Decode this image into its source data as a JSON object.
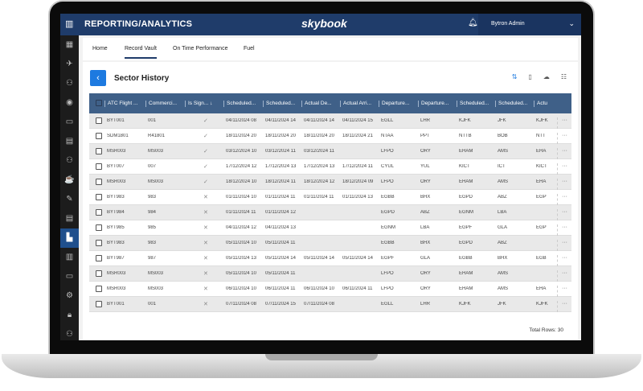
{
  "header": {
    "title": "REPORTING/ANALYTICS",
    "logo": "skybook",
    "user": "Bytron Admin",
    "app_icon": "bar-chart-icon",
    "bell_icon": "bell-icon",
    "chevron_icon": "chevron-down-icon"
  },
  "sidebar": {
    "icons": [
      "grid-icon",
      "drone-icon",
      "people-icon",
      "globe-icon",
      "monitor-icon",
      "list-icon",
      "people-settings-icon",
      "coffee-icon",
      "pin-icon",
      "clipboard-icon",
      "reports-icon",
      "columns-icon",
      "screen-icon",
      "gears-icon",
      "lock-icon",
      "user-icon"
    ],
    "active": 10
  },
  "tabs": [
    {
      "label": "Home"
    },
    {
      "label": "Record Vault",
      "active": true
    },
    {
      "label": "On Time Performance"
    },
    {
      "label": "Fuel"
    }
  ],
  "page": {
    "title": "Sector History",
    "back_icon": "chevron-left-icon",
    "tools": [
      "refresh-icon",
      "clipboard-icon",
      "cloud-download-icon",
      "columns-icon"
    ]
  },
  "table": {
    "columns": [
      "ATC Flight ...",
      "Commerci...",
      "Is Sign... ↓",
      "Scheduled...",
      "Scheduled...",
      "Actual De...",
      "Actual Arri...",
      "Departure...",
      "Departure...",
      "Scheduled...",
      "Scheduled...",
      "Actu"
    ],
    "rows": [
      [
        "BYT001",
        "001",
        "✓",
        "04/11/2024 08",
        "04/11/2024 14",
        "04/11/2024 14",
        "04/11/2024 15",
        "EGLL",
        "LHR",
        "KJFK",
        "JFK",
        "KJFK"
      ],
      [
        "SDM1801",
        "R41801",
        "✓",
        "18/11/2024 20",
        "18/11/2024 20",
        "18/11/2024 20",
        "18/11/2024 21",
        "NTAA",
        "PPT",
        "NTTB",
        "BOB",
        "NTT"
      ],
      [
        "MSR003",
        "MS003",
        "✓",
        "03/12/2024 10",
        "03/12/2024 11",
        "03/12/2024 11",
        "",
        "LFPO",
        "ORY",
        "EHAM",
        "AMS",
        "EHA"
      ],
      [
        "BYT007",
        "007",
        "✓",
        "17/12/2024 12",
        "17/12/2024 13",
        "17/12/2024 13",
        "17/12/2024 11",
        "CYUL",
        "YUL",
        "KICT",
        "ICT",
        "KICT"
      ],
      [
        "MSR003",
        "MS003",
        "✓",
        "18/12/2024 10",
        "18/12/2024 11",
        "18/12/2024 12",
        "18/12/2024 09",
        "LFPO",
        "ORY",
        "EHAM",
        "AMS",
        "EHA"
      ],
      [
        "BYT983",
        "983",
        "✕",
        "01/11/2024 10",
        "01/11/2024 11",
        "01/11/2024 11",
        "01/11/2024 13",
        "EGBB",
        "BHX",
        "EGPD",
        "ABZ",
        "EGP"
      ],
      [
        "BYT984",
        "984",
        "✕",
        "01/11/2024 11",
        "01/11/2024 12",
        "",
        "",
        "EGPD",
        "ABZ",
        "EGNM",
        "LBA",
        ""
      ],
      [
        "BYT985",
        "985",
        "✕",
        "04/11/2024 12",
        "04/11/2024 13",
        "",
        "",
        "EGNM",
        "LBA",
        "EGPF",
        "GLA",
        "EGP"
      ],
      [
        "BYT983",
        "983",
        "✕",
        "05/11/2024 10",
        "05/11/2024 11",
        "",
        "",
        "EGBB",
        "BHX",
        "EGPD",
        "ABZ",
        ""
      ],
      [
        "BYT987",
        "987",
        "✕",
        "05/11/2024 13",
        "05/11/2024 14",
        "05/11/2024 14",
        "05/11/2024 14",
        "EGPF",
        "GLA",
        "EGBB",
        "BHX",
        "EGB"
      ],
      [
        "MSR003",
        "MS003",
        "✕",
        "05/11/2024 10",
        "05/11/2024 11",
        "",
        "",
        "LFPO",
        "ORY",
        "EHAM",
        "AMS",
        ""
      ],
      [
        "MSR003",
        "MS003",
        "✕",
        "06/11/2024 10",
        "06/11/2024 11",
        "06/11/2024 10",
        "06/11/2024 11",
        "LFPO",
        "ORY",
        "EHAM",
        "AMS",
        "EHA"
      ],
      [
        "BYT001",
        "001",
        "✕",
        "07/11/2024 08",
        "07/11/2024 15",
        "07/11/2024 08",
        "",
        "EGLL",
        "LHR",
        "KJFK",
        "JFK",
        "KJFK"
      ]
    ],
    "more_icon": "more-horizontal-icon",
    "total": "Total Rows: 30"
  }
}
